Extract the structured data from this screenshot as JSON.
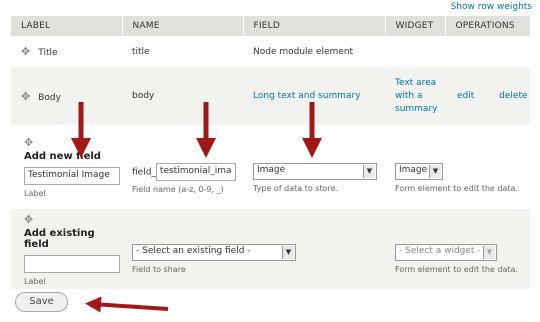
{
  "top_link": "Show row weights",
  "columns": [
    "LABEL",
    "NAME",
    "FIELD",
    "WIDGET",
    "OPERATIONS"
  ],
  "rows": {
    "title": {
      "label": "Title",
      "name": "title",
      "field": "Node module element"
    },
    "body": {
      "label": "Body",
      "name": "body",
      "field": "Long text and summary",
      "widget_lines": [
        "Text area",
        "with a",
        "summary"
      ],
      "edit": "edit",
      "delete": "delete"
    }
  },
  "new_field": {
    "heading": "Add new field",
    "label_value": "Testimonial Image",
    "label_caption": "Label",
    "name_prefix": "field_",
    "name_value": "testimonial_ima",
    "name_caption": "Field name (a-z, 0-9, _)",
    "field_type_value": "Image",
    "field_type_caption": "Type of data to store.",
    "widget_value": "Image",
    "widget_caption": "Form element to edit the data."
  },
  "existing_field": {
    "heading": "Add existing field",
    "label_value": "",
    "label_caption": "Label",
    "field_select": "- Select an existing field -",
    "field_caption": "Field to share",
    "widget_select": "- Select a widget -",
    "widget_caption": "Form element to edit the data."
  },
  "save_label": "Save",
  "colors": {
    "link": "#0074bd",
    "header_bg": "#e0e0dc",
    "arrow": "#a01818"
  }
}
